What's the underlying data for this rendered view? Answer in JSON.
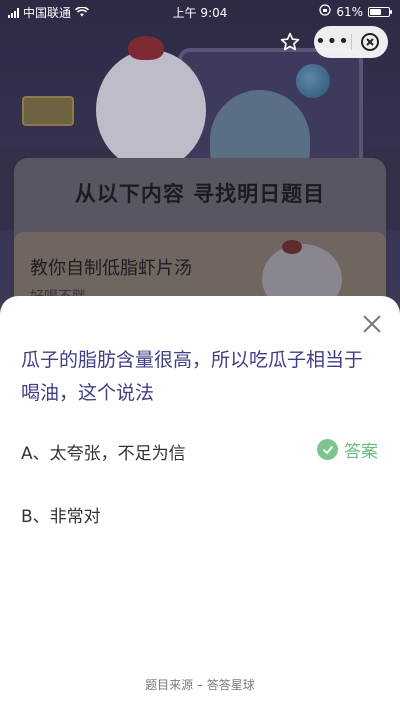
{
  "status_bar": {
    "carrier": "中国联通",
    "time": "上午 9:04",
    "battery_percent": "61%",
    "battery_level": 0.61
  },
  "background": {
    "card_title": "从以下内容 寻找明日题目",
    "inner_title": "教你自制低脂虾片汤",
    "inner_subtitle": "好喝不胖"
  },
  "capsule": {
    "more_label": "•••"
  },
  "sheet": {
    "question": "瓜子的脂肪含量很高，所以吃瓜子相当于喝油，这个说法",
    "options": [
      {
        "label": "A、太夸张，不足为信",
        "is_answer": true
      },
      {
        "label": "B、非常对",
        "is_answer": false
      }
    ],
    "answer_tag": "答案",
    "footer": "题目来源 – 答答星球"
  },
  "colors": {
    "question": "#3e3f86",
    "answer_green": "#69bd80",
    "sheet_bg": "#ffffff"
  }
}
